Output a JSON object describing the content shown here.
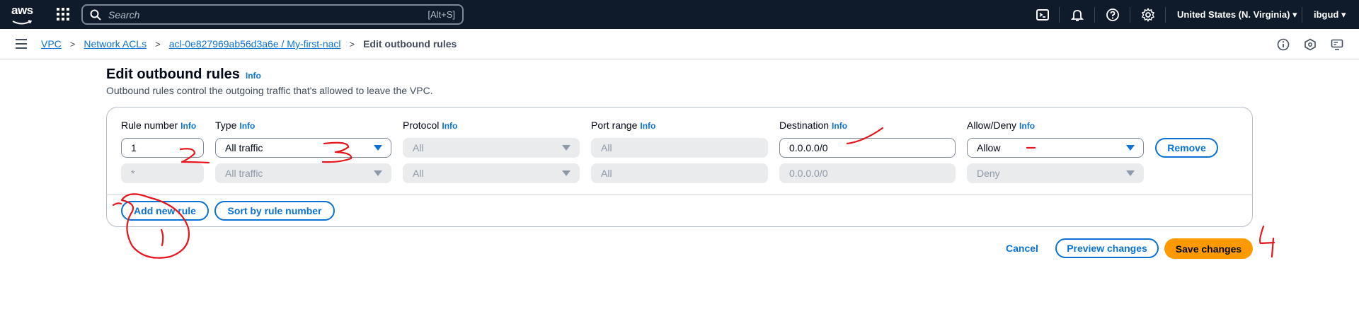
{
  "topnav": {
    "logo_text": "aws",
    "search_placeholder": "Search",
    "search_shortcut": "[Alt+S]",
    "region": "United States (N. Virginia) ▾",
    "user": "ibgud ▾",
    "icons": [
      "cloudshell-icon",
      "bell-icon",
      "help-icon",
      "gear-icon"
    ]
  },
  "breadcrumb": {
    "items": [
      "VPC",
      "Network ACLs",
      "acl-0e827969ab56d3a6e / My-first-nacl"
    ],
    "current": "Edit outbound rules",
    "separator": ">"
  },
  "page": {
    "title": "Edit outbound rules",
    "title_info": "Info",
    "description": "Outbound rules control the outgoing traffic that's allowed to leave the VPC."
  },
  "columns": {
    "rule_number": "Rule number",
    "type": "Type",
    "protocol": "Protocol",
    "port_range": "Port range",
    "destination": "Destination",
    "allow_deny": "Allow/Deny",
    "info": "Info"
  },
  "rows": [
    {
      "rule_number": "1",
      "type": "All traffic",
      "protocol": "All",
      "port_range": "All",
      "destination": "0.0.0.0/0",
      "allow_deny": "Allow",
      "remove_label": "Remove"
    },
    {
      "rule_number": "*",
      "type": "All traffic",
      "protocol": "All",
      "port_range": "All",
      "destination": "0.0.0.0/0",
      "allow_deny": "Deny"
    }
  ],
  "actions": {
    "add_rule": "Add new rule",
    "sort_rules": "Sort by rule number",
    "cancel": "Cancel",
    "preview": "Preview changes",
    "save": "Save changes"
  },
  "annotations": {
    "color": "#e8141c",
    "marks": [
      "1",
      "2",
      "3",
      "4"
    ]
  }
}
